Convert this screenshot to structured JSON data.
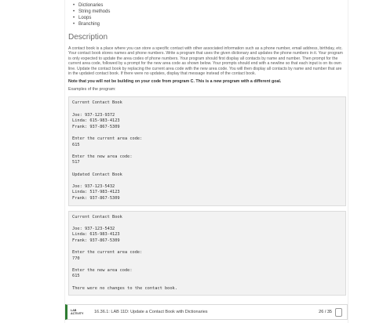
{
  "topics": [
    "Dictionaries",
    "String methods",
    "Loops",
    "Branching"
  ],
  "bullet": "•",
  "heading": "Description",
  "description": "A contact book is a place where you can store a specific contact with other associated information such as a phone number, email address, birthday, etc. Your contact book stores names and phone numbers. Write a program that uses the given dictionary and updates the phone numbers in it. Your program is only expected to update the area codes of phone numbers. Your program should first display all contacts by name and number. Then prompt for the current area code, followed by a prompt for the new area code as shown below. Your prompts should end with a newline so that each input is on its own line. Update the contact book by replacing the current area code with the new area code. You will then display all contacts by name and number that are in the updated contact book. If there were no updates, display that message instead of the contact book.",
  "note": "Note that you will not be building on your code from program C. This is a new program with a different goal.",
  "examples_label": "Examples of the program:",
  "example1": [
    "Current Contact Book",
    "",
    "Joe: 937-123-9372",
    "Linda: 615-983-4123",
    "Frank: 937-867-5309",
    "",
    "Enter the current area code:",
    "615",
    "",
    "Enter the new area code:",
    "517",
    "",
    "Updated Contact Book",
    "",
    "Joe: 937-123-5432",
    "Linda: 517-983-4123",
    "Frank: 937-867-5309"
  ],
  "example2": [
    "Current Contact Book",
    "",
    "Joe: 937-123-5432",
    "Linda: 615-983-4123",
    "Frank: 937-867-5309",
    "",
    "Enter the current area code:",
    "770",
    "",
    "Enter the new area code:",
    "615",
    "",
    "There were no changes to the contact book."
  ],
  "footer": {
    "tag_line1": "LAB",
    "tag_line2": "ACTIVITY",
    "title": "16.36.1: LAB 11D: Update a Contact Book with Dictionaries",
    "score": "26 / 35"
  },
  "colors": {
    "accent": "#2e7d32",
    "code_bg": "#f2f2f2"
  }
}
